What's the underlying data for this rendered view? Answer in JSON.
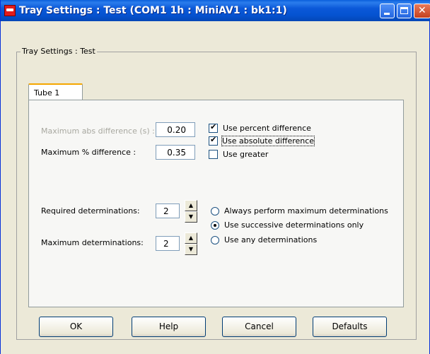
{
  "window": {
    "title": "Tray Settings : Test (COM1 1h : MiniAV1 : bk1:1)"
  },
  "group": {
    "legend": "Tray Settings : Test"
  },
  "tabs": [
    {
      "label": "Tube 1",
      "selected": true
    }
  ],
  "difference": {
    "max_abs_label": "Maximum abs difference (s) :",
    "max_abs_value": "0.20",
    "max_pct_label": "Maximum % difference :",
    "max_pct_value": "0.35",
    "use_percent_label": "Use percent difference",
    "use_percent_checked": true,
    "use_absolute_label": "Use absolute difference",
    "use_absolute_checked": true,
    "use_greater_label": "Use greater",
    "use_greater_checked": false
  },
  "determinations": {
    "required_label": "Required determinations:",
    "required_value": "2",
    "maximum_label": "Maximum determinations:",
    "maximum_value": "2",
    "options": [
      {
        "label": "Always perform maximum determinations",
        "selected": false
      },
      {
        "label": "Use successive determinations only",
        "selected": true
      },
      {
        "label": "Use any determinations",
        "selected": false
      }
    ]
  },
  "buttons": {
    "ok": "OK",
    "help": "Help",
    "cancel": "Cancel",
    "defaults": "Defaults"
  },
  "icons": {
    "app": "app-icon",
    "minimize": "minimize-icon",
    "maximize": "maximize-icon",
    "close": "close-icon",
    "spin_up": "arrow-up-icon",
    "spin_down": "arrow-down-icon"
  },
  "colors": {
    "title_bar": "#0553d1",
    "dialog_bg": "#ece9d8",
    "disabled_text": "#a8a8a0"
  }
}
